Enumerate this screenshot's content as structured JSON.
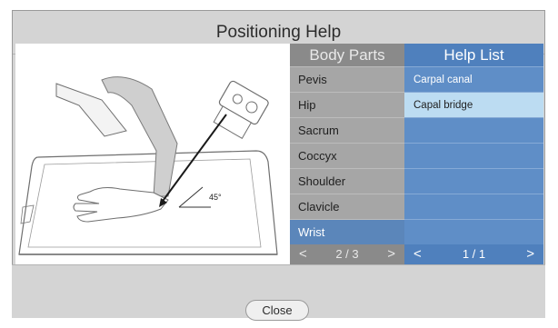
{
  "dialog": {
    "title": "Positioning Help",
    "close_label": "Close"
  },
  "illustration": {
    "angle_label": "45°"
  },
  "body_parts": {
    "header": "Body Parts",
    "items": [
      "Pevis",
      "Hip",
      "Sacrum",
      "Coccyx",
      "Shoulder",
      "Clavicle",
      "Wrist"
    ],
    "selected": "Wrist",
    "pager": {
      "prev": "<",
      "page": "2 / 3",
      "next": ">"
    }
  },
  "help_list": {
    "header": "Help List",
    "items": [
      "Carpal canal",
      "Capal bridge"
    ],
    "selected": "Capal bridge",
    "pager": {
      "prev": "<",
      "page": "1 / 1",
      "next": ">"
    }
  }
}
